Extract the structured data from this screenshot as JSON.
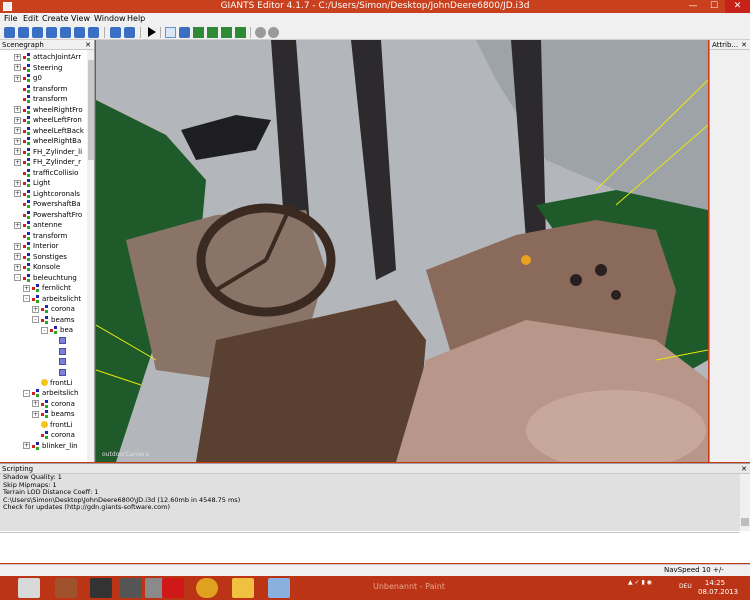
{
  "window": {
    "title": "GIANTS Editor 4.1.7 - C:/Users/Simon/Desktop/JohnDeere6800/JD.i3d",
    "min": "—",
    "max": "☐",
    "close": "✕"
  },
  "menu": [
    "File",
    "Edit",
    "Create",
    "View",
    "Window",
    "Help"
  ],
  "scenegraph": {
    "title": "Scenegraph",
    "close": "✕",
    "nodes": [
      {
        "label": "attachJointArr",
        "depth": 1,
        "exp": "+",
        "icon": "transform"
      },
      {
        "label": "Steering",
        "depth": 1,
        "exp": "+",
        "icon": "transform"
      },
      {
        "label": "g0",
        "depth": 1,
        "exp": "+",
        "icon": "transform"
      },
      {
        "label": "transform",
        "depth": 1,
        "exp": "",
        "icon": "transform"
      },
      {
        "label": "transform",
        "depth": 1,
        "exp": "",
        "icon": "transform"
      },
      {
        "label": "wheelRightFro",
        "depth": 1,
        "exp": "+",
        "icon": "mesh"
      },
      {
        "label": "wheelLeftFron",
        "depth": 1,
        "exp": "+",
        "icon": "mesh"
      },
      {
        "label": "wheelLeftBack",
        "depth": 1,
        "exp": "+",
        "icon": "mesh"
      },
      {
        "label": "wheelRightBa",
        "depth": 1,
        "exp": "+",
        "icon": "mesh"
      },
      {
        "label": "FH_Zylinder_li",
        "depth": 1,
        "exp": "+",
        "icon": "mesh"
      },
      {
        "label": "FH_Zylinder_r",
        "depth": 1,
        "exp": "+",
        "icon": "mesh"
      },
      {
        "label": "trafficCollisio",
        "depth": 1,
        "exp": "",
        "icon": "mesh"
      },
      {
        "label": "Light",
        "depth": 1,
        "exp": "+",
        "icon": "transform"
      },
      {
        "label": "Lightcoronals",
        "depth": 1,
        "exp": "+",
        "icon": "transform"
      },
      {
        "label": "PowershaftBa",
        "depth": 1,
        "exp": "",
        "icon": "transform"
      },
      {
        "label": "PowershaftFro",
        "depth": 1,
        "exp": "",
        "icon": "transform"
      },
      {
        "label": "antenne",
        "depth": 1,
        "exp": "+",
        "icon": "transform"
      },
      {
        "label": "transform",
        "depth": 1,
        "exp": "",
        "icon": "transform"
      },
      {
        "label": "Interior",
        "depth": 1,
        "exp": "+",
        "icon": "transform"
      },
      {
        "label": "Sonstiges",
        "depth": 1,
        "exp": "+",
        "icon": "transform"
      },
      {
        "label": "Konsole",
        "depth": 1,
        "exp": "+",
        "icon": "transform"
      },
      {
        "label": "beleuchtung",
        "depth": 1,
        "exp": "-",
        "icon": "transform"
      },
      {
        "label": "fernlicht",
        "depth": 2,
        "exp": "+",
        "icon": "transform"
      },
      {
        "label": "arbeitslicht",
        "depth": 2,
        "exp": "-",
        "icon": "transform"
      },
      {
        "label": "corona",
        "depth": 3,
        "exp": "+",
        "icon": "transform"
      },
      {
        "label": "beams",
        "depth": 3,
        "exp": "-",
        "icon": "transform"
      },
      {
        "label": "bea",
        "depth": 4,
        "exp": "-",
        "icon": "transform"
      },
      {
        "label": "",
        "depth": 5,
        "exp": "",
        "icon": "cube"
      },
      {
        "label": "",
        "depth": 5,
        "exp": "",
        "icon": "cube"
      },
      {
        "label": "",
        "depth": 5,
        "exp": "",
        "icon": "cube"
      },
      {
        "label": "",
        "depth": 5,
        "exp": "",
        "icon": "cube"
      },
      {
        "label": "frontLi",
        "depth": 3,
        "exp": "",
        "icon": "light"
      },
      {
        "label": "arbeitslich",
        "depth": 2,
        "exp": "-",
        "icon": "transform"
      },
      {
        "label": "corona",
        "depth": 3,
        "exp": "+",
        "icon": "transform"
      },
      {
        "label": "beams",
        "depth": 3,
        "exp": "+",
        "icon": "transform"
      },
      {
        "label": "frontLi",
        "depth": 3,
        "exp": "",
        "icon": "light"
      },
      {
        "label": "corona",
        "depth": 3,
        "exp": "",
        "icon": "transform"
      },
      {
        "label": "blinker_lin",
        "depth": 2,
        "exp": "+",
        "icon": "transform"
      }
    ]
  },
  "viewport": {
    "camera_label": "outdoorCamera",
    "colors": {
      "background": "#b3b7bb",
      "cab_green": "#1f5a2a",
      "seat": "#b8968a",
      "console": "#8a6a5a",
      "wheel": "#3a2a22",
      "floor": "#5a4030"
    }
  },
  "attributes": {
    "title": "Attrib...",
    "close": "✕"
  },
  "scripting": {
    "title": "Scripting",
    "close": "✕",
    "lines": [
      "  Shadow Quality: 1",
      "  Skip Mipmaps: 1",
      "  Terrain LOD Distance Coeff: 1",
      "C:\\Users\\Simon\\Desktop\\JohnDeere6800\\JD.i3d (12.60mb in 4548.75 ms)",
      "Check for updates (http://gdn.giants-software.com)"
    ]
  },
  "status": {
    "navspeed": "NavSpeed 10 +/-"
  },
  "taskbar": {
    "ghost_paint": "Unbenannt - Paint",
    "lang": "DEU",
    "time": "14:25",
    "date": "08.07.2013",
    "colors": {
      "bar": "#bb3416"
    }
  }
}
